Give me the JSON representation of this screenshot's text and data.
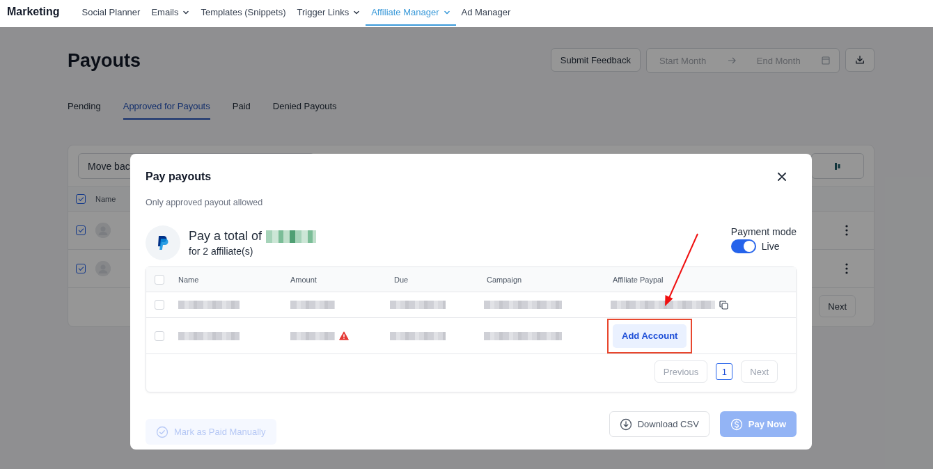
{
  "nav": {
    "brand": "Marketing",
    "items": [
      {
        "label": "Social Planner",
        "dropdown": false,
        "selected": false
      },
      {
        "label": "Emails",
        "dropdown": true,
        "selected": false
      },
      {
        "label": "Templates (Snippets)",
        "dropdown": false,
        "selected": false
      },
      {
        "label": "Trigger Links",
        "dropdown": true,
        "selected": false
      },
      {
        "label": "Affiliate Manager",
        "dropdown": true,
        "selected": true
      },
      {
        "label": "Ad Manager",
        "dropdown": false,
        "selected": false
      }
    ]
  },
  "page": {
    "title": "Payouts",
    "feedback_button": "Submit Feedback",
    "date_range": {
      "start_placeholder": "Start Month",
      "end_placeholder": "End Month"
    },
    "tabs": [
      {
        "label": "Pending",
        "selected": false
      },
      {
        "label": "Approved for Payouts",
        "selected": true
      },
      {
        "label": "Paid",
        "selected": false
      },
      {
        "label": "Denied Payouts",
        "selected": false
      }
    ],
    "table": {
      "toolbar_button": "Move bac",
      "header_checked": true,
      "column_1": "Name",
      "rows": [
        {
          "checked": true
        },
        {
          "checked": true
        }
      ],
      "next_button": "Next"
    }
  },
  "modal": {
    "title": "Pay payouts",
    "subtitle": "Only approved payout allowed",
    "total_label": "Pay a total of",
    "affiliates": "for 2 affiliate(s)",
    "payment_mode": {
      "label": "Payment mode",
      "on": true,
      "value": "Live"
    },
    "table": {
      "header_checked": false,
      "columns": [
        "Name",
        "Amount",
        "Due",
        "Campaign",
        "Affiliate Paypal"
      ],
      "rows": [
        {
          "checked": false,
          "cells": [
            {
              "kind": "redacted"
            },
            {
              "kind": "redacted",
              "warning": false
            },
            {
              "kind": "redacted"
            },
            {
              "kind": "redacted"
            },
            {
              "kind": "redacted",
              "copy": true
            }
          ]
        },
        {
          "checked": false,
          "cells": [
            {
              "kind": "redacted"
            },
            {
              "kind": "redacted",
              "warning": true
            },
            {
              "kind": "redacted"
            },
            {
              "kind": "redacted"
            },
            {
              "kind": "button",
              "label": "Add Account",
              "highlighted": true
            }
          ]
        }
      ]
    },
    "pagination": {
      "previous": {
        "label": "Previous",
        "disabled": true
      },
      "pages": [
        {
          "label": "1",
          "selected": true
        }
      ],
      "next": {
        "label": "Next",
        "disabled": true
      }
    },
    "buttons": [
      {
        "kind": "mark_paid",
        "label": "Mark as Paid Manually",
        "disabled": true
      },
      {
        "kind": "download",
        "label": "Download CSV",
        "disabled": false
      },
      {
        "kind": "pay",
        "label": "Pay Now",
        "disabled": true
      }
    ]
  },
  "annotations": [
    {
      "kind": "arrow"
    }
  ]
}
